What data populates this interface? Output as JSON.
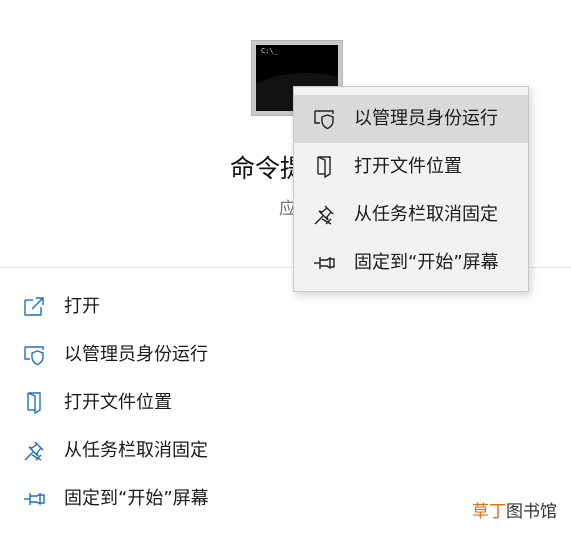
{
  "app": {
    "name": "命令提示符",
    "type": "应用",
    "icon": "command-prompt-icon",
    "icon_prompt": "C:\\_"
  },
  "actions": [
    {
      "label": "打开",
      "icon": "open-external-icon"
    },
    {
      "label": "以管理员身份运行",
      "icon": "shield-window-icon"
    },
    {
      "label": "打开文件位置",
      "icon": "folder-location-icon"
    },
    {
      "label": "从任务栏取消固定",
      "icon": "unpin-icon"
    },
    {
      "label": "固定到“开始”屏幕",
      "icon": "pin-icon"
    }
  ],
  "context_menu": {
    "items": [
      {
        "label": "以管理员身份运行",
        "icon": "shield-window-icon",
        "highlighted": true
      },
      {
        "label": "打开文件位置",
        "icon": "folder-location-icon",
        "highlighted": false
      },
      {
        "label": "从任务栏取消固定",
        "icon": "unpin-icon",
        "highlighted": false
      },
      {
        "label": "固定到“开始”屏幕",
        "icon": "pin-icon",
        "highlighted": false
      }
    ]
  },
  "watermark": {
    "part1": "草丁",
    "part2": "图书馆"
  },
  "colors": {
    "icon_blue": "#1f6fbf",
    "menu_background": "#f2f2f2",
    "menu_highlight": "#d9d9d9",
    "watermark_accent": "#e46a12"
  }
}
